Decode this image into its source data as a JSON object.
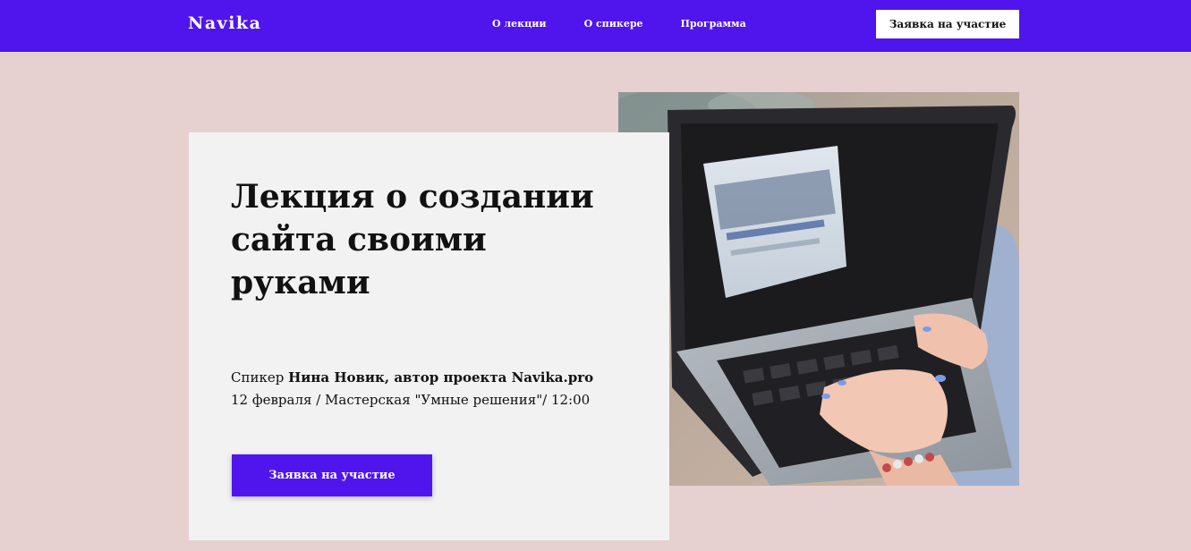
{
  "header": {
    "logo": "Navika",
    "nav": [
      {
        "label": "О лекции"
      },
      {
        "label": "О спикере"
      },
      {
        "label": "Программа"
      }
    ],
    "cta_label": "Заявка на участие"
  },
  "hero": {
    "title": "Лекция о создании сайта своими руками",
    "speaker_prefix": "Спикер ",
    "speaker_name": "Нина Новик, автор проекта Navika.pro",
    "details": "12 февраля / Мастерская \"Умные решения\"/ 12:00",
    "cta_label": "Заявка на участие",
    "image_icon": "laptop-photo"
  },
  "colors": {
    "accent": "#4f15ec",
    "background": "#e7d0d0",
    "card": "#f2f2f2"
  }
}
